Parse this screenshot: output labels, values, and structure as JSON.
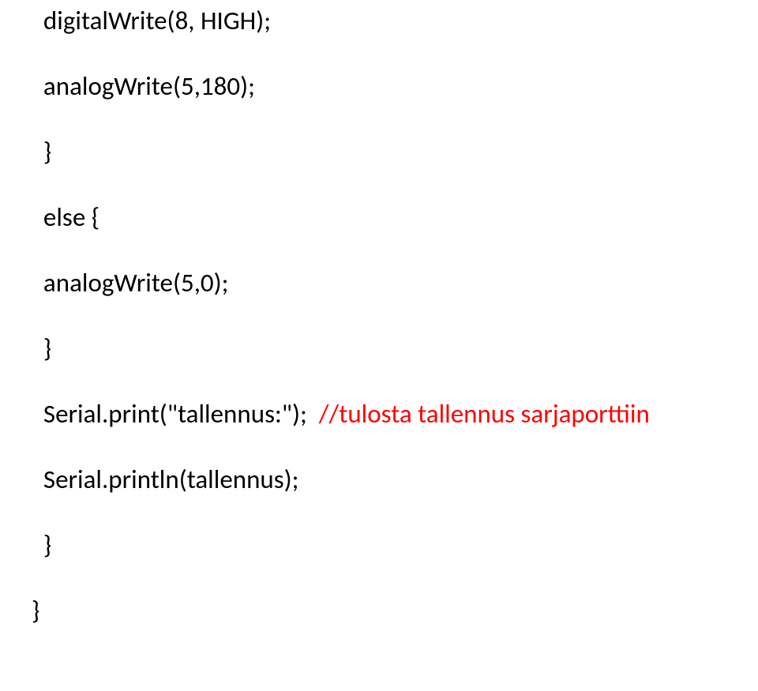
{
  "lines": {
    "l1": "  digitalWrite(8, HIGH);",
    "l2": "  analogWrite(5,180);",
    "l3": "  }",
    "l4": "  else {",
    "l5": "  analogWrite(5,0);",
    "l6": "  }",
    "l7_code": "  Serial.print(\"tallennus:\");  ",
    "l7_comment": "//tulosta tallennus sarjaporttiin",
    "l8": "  Serial.println(tallennus);",
    "l9": "  }",
    "l10": "}"
  }
}
